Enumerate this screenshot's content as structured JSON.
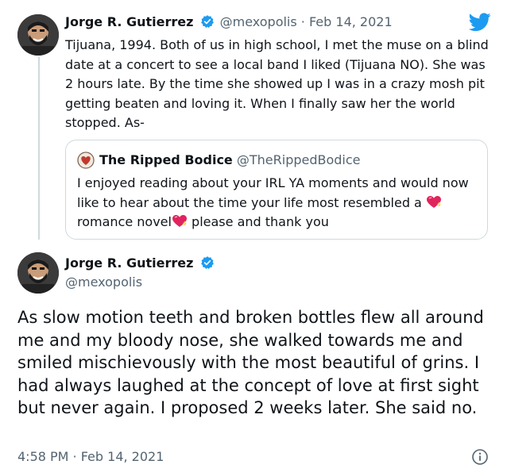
{
  "tweet1": {
    "author_name": "Jorge R. Gutierrez",
    "handle_date": "@mexopolis · Feb 14, 2021",
    "text": "Tijuana, 1994. Both of us in high school, I met the muse on a blind date at a concert to see a local band I liked (Tijuana NO). She was 2 hours late. By the time she showed up I was in a crazy mosh pit getting beaten and loving it. When I finally saw her the world stopped. As-"
  },
  "quote": {
    "author_name": "The Ripped Bodice",
    "handle": "@TheRippedBodice",
    "text_part1": "I enjoyed reading about your IRL YA  moments and would now like to hear about the time your life most resembled a ",
    "text_part2": "romance novel",
    "text_part3": " please and thank you"
  },
  "tweet2": {
    "author_name": "Jorge R. Gutierrez",
    "handle": "@mexopolis",
    "text": "As slow motion teeth and broken bottles flew all around me and my bloody nose, she walked towards me and smiled mischievously with the most beautiful of grins. I had always laughed at the concept of love at first sight but never again. I proposed 2 weeks later. She said no.",
    "timestamp": "4:58 PM · Feb 14, 2021"
  },
  "icons": {
    "brand": "twitter-bird-icon",
    "verified": "verified-badge-icon",
    "heart": "heart-emoji-icon",
    "info": "info-icon"
  },
  "colors": {
    "twitter_blue": "#1d9bf0",
    "text": "#0f1419",
    "secondary": "#536471",
    "border": "#cfd9de"
  }
}
